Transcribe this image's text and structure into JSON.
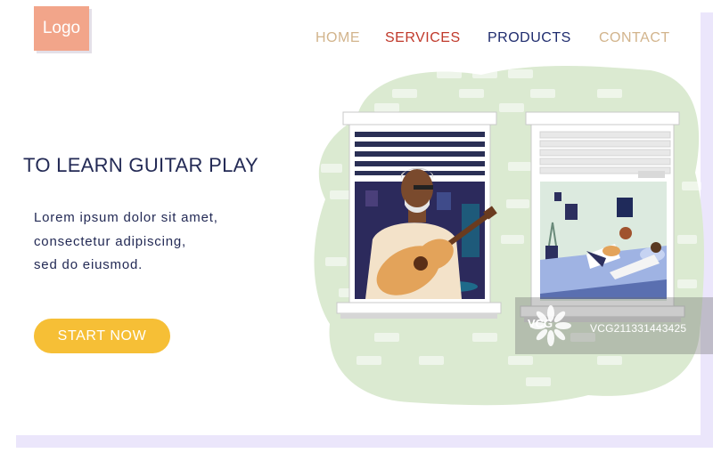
{
  "header": {
    "logo_label": "Logo",
    "nav": {
      "home": "HOME",
      "services": "SERVICES",
      "products": "PRODUCTS",
      "contact": "CONTACT"
    }
  },
  "hero": {
    "title": "TO LEARN GUITAR PLAY",
    "body_lines": [
      "Lorem ipsum dolor sit amet,",
      "consectetur adipiscing,",
      "sed do eiusmod."
    ],
    "cta_label": "START NOW"
  },
  "watermark": {
    "brand": "VCG",
    "id_text": "VCG211331443425"
  },
  "colors": {
    "logo_bg": "#f2a58a",
    "nav_home": "#d2b48c",
    "nav_services": "#c0392b",
    "nav_products": "#1f2c6e",
    "nav_contact": "#d2b48c",
    "text_dark": "#232a55",
    "cta_bg": "#f6bf36",
    "blob_green": "#dbead1"
  }
}
